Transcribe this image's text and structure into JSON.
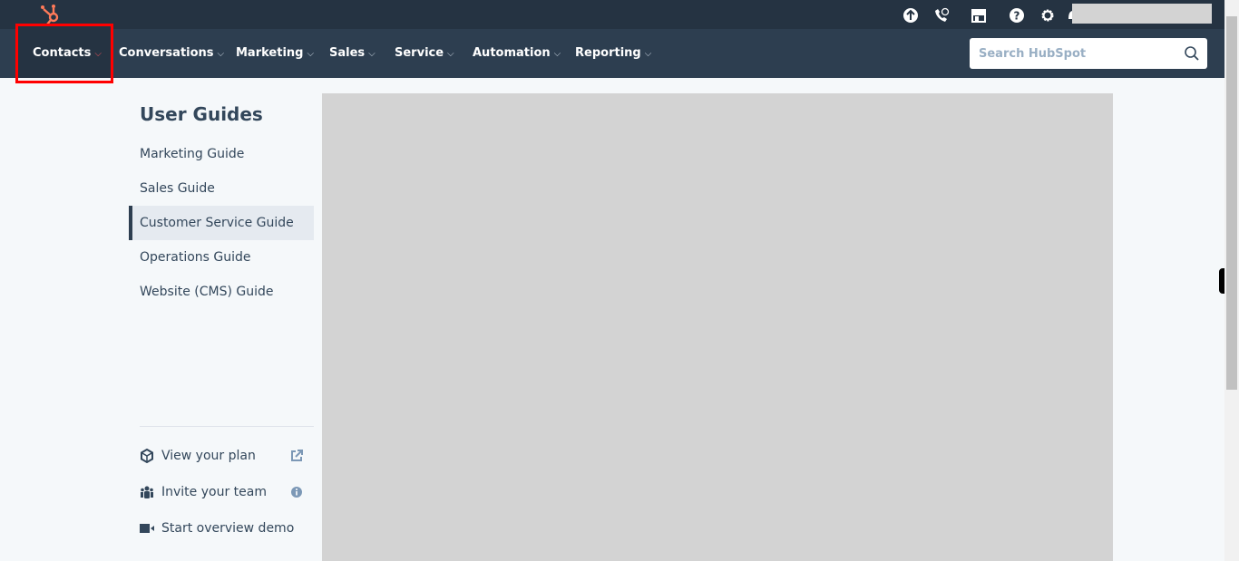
{
  "topbar": {
    "icons": [
      "upgrade-icon",
      "calling-icon",
      "marketplace-icon",
      "help-icon",
      "settings-icon",
      "notifications-icon"
    ]
  },
  "nav": {
    "items": [
      {
        "label": "Contacts"
      },
      {
        "label": "Conversations"
      },
      {
        "label": "Marketing"
      },
      {
        "label": "Sales"
      },
      {
        "label": "Service"
      },
      {
        "label": "Automation"
      },
      {
        "label": "Reporting"
      }
    ],
    "chevron": "⌵"
  },
  "search": {
    "placeholder": "Search HubSpot",
    "value": ""
  },
  "guides": {
    "title": "User Guides",
    "items": [
      {
        "label": "Marketing Guide"
      },
      {
        "label": "Sales Guide"
      },
      {
        "label": "Customer Service Guide",
        "active": true
      },
      {
        "label": "Operations Guide"
      },
      {
        "label": "Website (CMS) Guide"
      }
    ]
  },
  "footer": {
    "items": [
      {
        "label": "View your plan",
        "icon": "cube-icon",
        "right": "external-link-icon"
      },
      {
        "label": "Invite your team",
        "icon": "team-icon",
        "right": "info-icon"
      },
      {
        "label": "Start overview demo",
        "icon": "video-camera-icon"
      }
    ]
  },
  "colors": {
    "topbar": "#253342",
    "nav": "#2d3e50",
    "accent": "#ff7a59",
    "highlight": "#ff0000"
  }
}
